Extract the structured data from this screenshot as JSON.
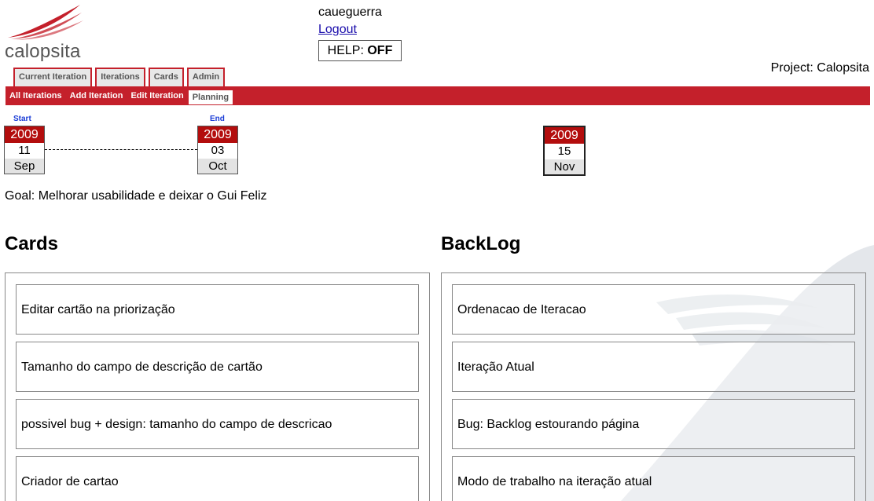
{
  "logo": {
    "text": "calopsita",
    "brand_color": "#c4202b"
  },
  "user": {
    "username": "caueguerra",
    "logout_label": "Logout",
    "help_label": "HELP:",
    "help_state": "OFF"
  },
  "project": {
    "label": "Project: Calopsita"
  },
  "tabs": [
    {
      "label": "Current Iteration"
    },
    {
      "label": "Iterations"
    },
    {
      "label": "Cards"
    },
    {
      "label": "Admin"
    }
  ],
  "subnav": [
    {
      "label": "All Iterations",
      "active": false
    },
    {
      "label": "Add Iteration",
      "active": false
    },
    {
      "label": "Edit Iteration",
      "active": false
    },
    {
      "label": "Planning",
      "active": true
    }
  ],
  "timeline": {
    "start": {
      "label": "Start",
      "year": "2009",
      "day": "11",
      "month": "Sep"
    },
    "end": {
      "label": "End",
      "year": "2009",
      "day": "03",
      "month": "Oct"
    },
    "today": {
      "year": "2009",
      "day": "15",
      "month": "Nov"
    }
  },
  "goal": "Goal: Melhorar usabilidade e deixar o Gui Feliz",
  "cards_section": {
    "title": "Cards",
    "items": [
      "Editar cartão na priorização",
      "Tamanho do campo de descrição de cartão",
      "possivel bug + design: tamanho do campo de descricao",
      "Criador de cartao"
    ]
  },
  "backlog_section": {
    "title": "BackLog",
    "items": [
      "Ordenacao de Iteracao",
      "Iteração Atual",
      "Bug: Backlog estourando página",
      "Modo de trabalho na iteração atual"
    ]
  },
  "colors": {
    "accent_red": "#c4202b",
    "calendar_red": "#b30d0d",
    "link_blue": "#1a0dab",
    "label_blue": "#1a3cd6"
  }
}
